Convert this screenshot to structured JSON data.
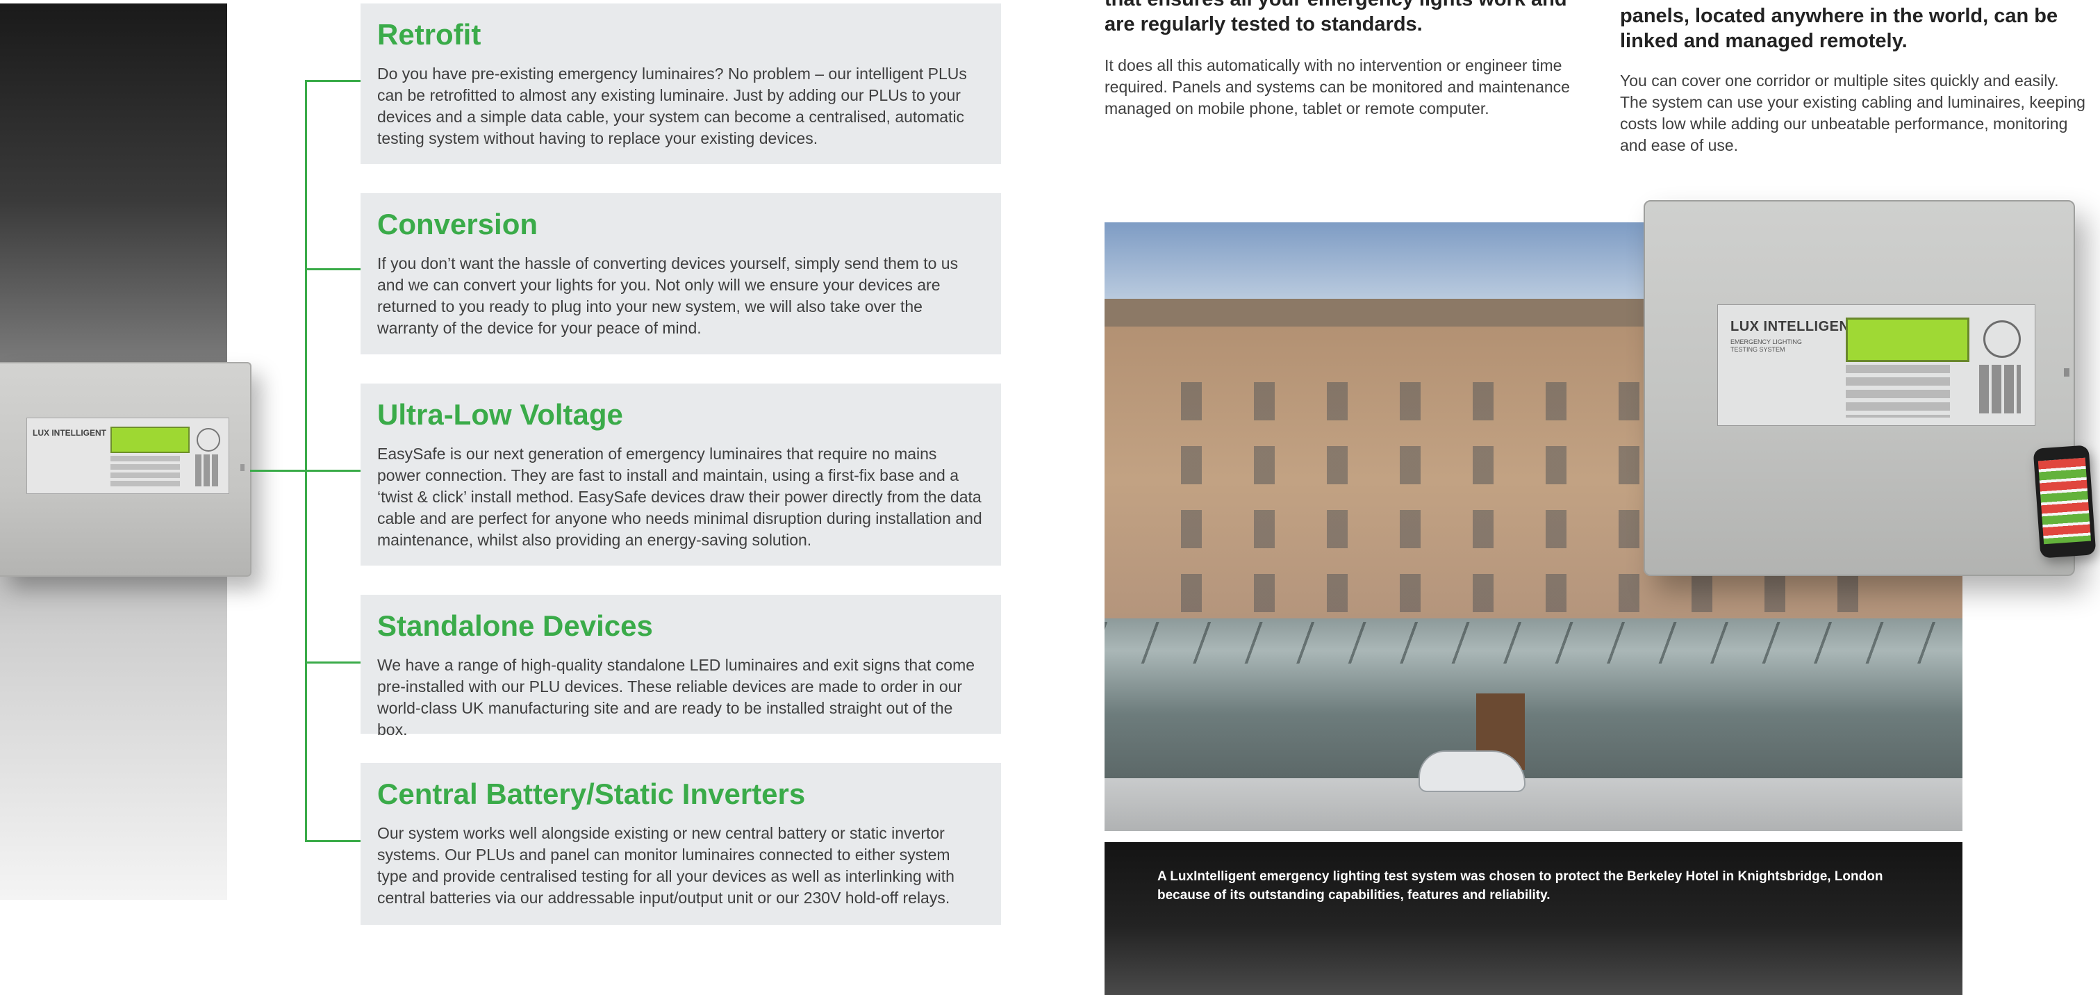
{
  "cards": [
    {
      "title": "Retrofit",
      "body": "Do you have pre-existing emergency luminaires? No problem – our intelligent PLUs can be retrofitted to almost any existing luminaire. Just by adding our PLUs to your devices and a simple data cable, your system can become a centralised, automatic testing system without having to replace your existing devices."
    },
    {
      "title": "Conversion",
      "body": "If you don’t want the hassle of converting devices yourself, simply send them to us and we can convert your lights for you. Not only will we ensure your devices are returned to you ready to plug into your new system, we will also take over the warranty of the device for your peace of mind."
    },
    {
      "title": "Ultra-Low Voltage",
      "body": "EasySafe is our next generation of emergency luminaires that require no mains power connection. They are fast to install and maintain, using a first-fix base and a ‘twist & click’ install method. EasySafe devices draw their power directly from the data cable and are perfect for anyone who needs minimal disruption during installation and maintenance, whilst also providing an energy-saving solution."
    },
    {
      "title": "Standalone Devices",
      "body": "We have a range of high-quality standalone LED luminaires and exit signs that come pre-installed with our PLU devices. These reliable devices are made to order in our world-class UK manufacturing site and are ready to be installed straight out of the box."
    },
    {
      "title": "Central Battery/Static Inverters",
      "body": "Our system works well alongside existing or new central battery or static invertor systems. Our PLUs and panel can monitor luminaires connected to either system type and provide centralised testing for all your devices as well as interlinking with central batteries via our addressable input/output unit or our 230V hold-off relays."
    }
  ],
  "right_page": {
    "col1_heading": "that ensures all your emergency lights work and are regularly tested to standards.",
    "col1_body": "It does all this automatically with no intervention or engineer time required. Panels and systems can be monitored and maintenance managed on mobile phone, tablet or remote computer.",
    "col2_heading": "panels, located anywhere in the world, can be linked and managed remotely.",
    "col2_body": "You can cover one corridor or multiple sites quickly and easily. The system can use your existing cabling and luminaires, keeping costs low while adding our unbeatable performance, monitoring and ease of use."
  },
  "caption": "A LuxIntelligent emergency lighting test system was chosen to protect the Berkeley Hotel in Knightsbridge, London because of its outstanding capabilities, features and reliability.",
  "device": {
    "brand": "LUX INTELLIGENT",
    "subtitle_line1": "EMERGENCY LIGHTING",
    "subtitle_line2": "TESTING SYSTEM"
  },
  "colors": {
    "accent_green": "#3aab49",
    "card_bg": "#e8eaec",
    "caption_bg": "#1a1a1a"
  }
}
